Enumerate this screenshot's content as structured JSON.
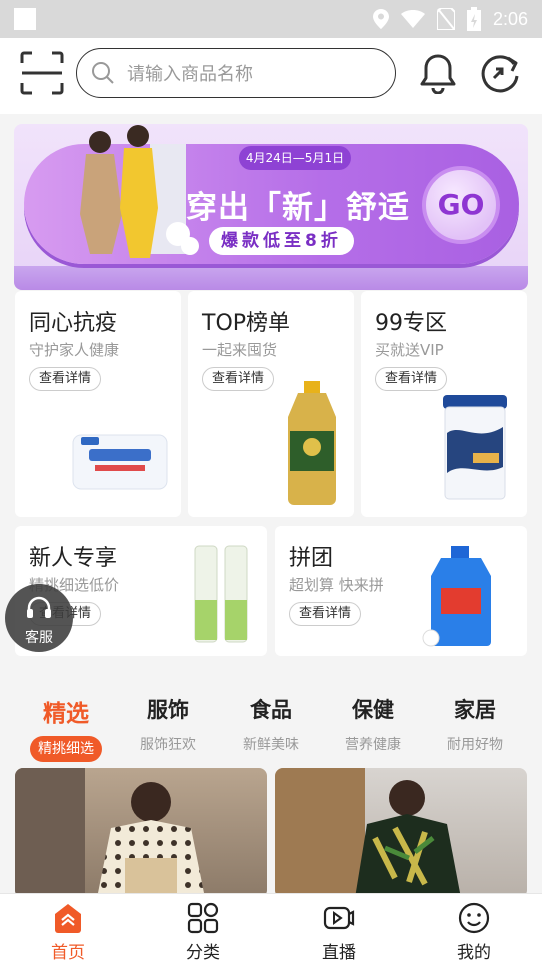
{
  "status_bar": {
    "time": "2:06"
  },
  "header": {
    "search_placeholder": "请输入商品名称"
  },
  "banner": {
    "date_range": "4月24日—5月1日",
    "title": "穿出「新」舒适",
    "subtitle": "爆款低至8折",
    "go_label": "GO"
  },
  "cards": [
    {
      "title": "同心抗疫",
      "subtitle": "守护家人健康",
      "button": "查看详情"
    },
    {
      "title": "TOP榜单",
      "subtitle": "一起来囤货",
      "button": "查看详情"
    },
    {
      "title": "99专区",
      "subtitle": "买就送VIP",
      "button": "查看详情"
    },
    {
      "title": "新人专享",
      "subtitle": "精挑细选低价",
      "button": "查看详情"
    },
    {
      "title": "拼团",
      "subtitle": "超划算 快来拼",
      "button": "查看详情"
    }
  ],
  "service": {
    "label": "客服"
  },
  "tabs": [
    {
      "label": "精选",
      "sub": "精挑细选",
      "active": true
    },
    {
      "label": "服饰",
      "sub": "服饰狂欢"
    },
    {
      "label": "食品",
      "sub": "新鲜美味"
    },
    {
      "label": "保健",
      "sub": "营养健康"
    },
    {
      "label": "家居",
      "sub": "耐用好物"
    }
  ],
  "bottom_nav": [
    {
      "label": "首页",
      "icon": "home-icon",
      "active": true
    },
    {
      "label": "分类",
      "icon": "grid-icon"
    },
    {
      "label": "直播",
      "icon": "live-video-icon"
    },
    {
      "label": "我的",
      "icon": "profile-face-icon"
    }
  ],
  "colors": {
    "accent": "#f05a28",
    "banner_purple": "#b56ee8"
  }
}
